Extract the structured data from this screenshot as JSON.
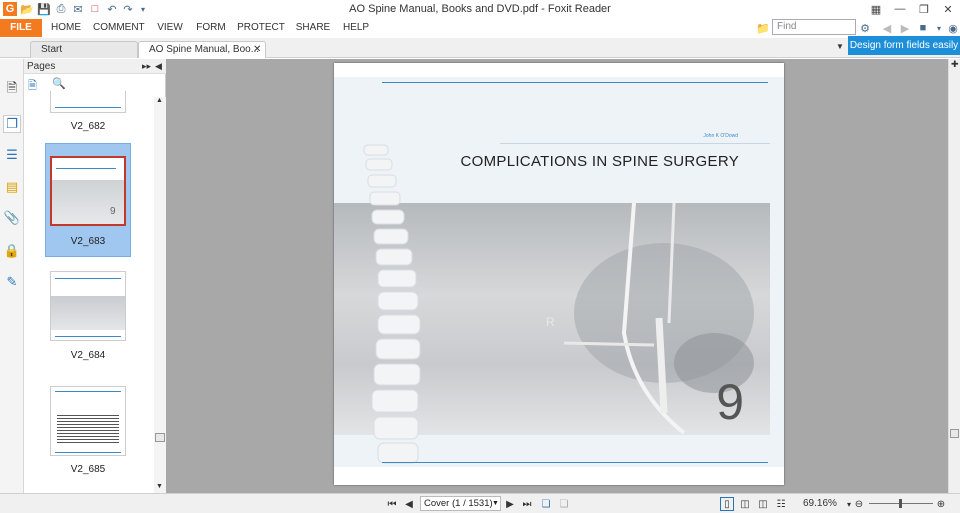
{
  "window": {
    "title": "AO Spine Manual, Books and DVD.pdf - Foxit Reader"
  },
  "quick_access": [
    "app-icon",
    "open-icon",
    "save-icon",
    "print-icon",
    "email-icon",
    "new-icon",
    "undo-icon",
    "redo-icon",
    "more-icon"
  ],
  "menu": {
    "items": [
      "FILE",
      "HOME",
      "COMMENT",
      "VIEW",
      "FORM",
      "PROTECT",
      "SHARE",
      "HELP"
    ]
  },
  "search": {
    "placeholder": "Find"
  },
  "tabs": [
    {
      "label": "Start"
    },
    {
      "label": "AO Spine Manual, Boo..."
    }
  ],
  "promo": {
    "text": "Design form fields easily"
  },
  "sidebar": {
    "panel_title": "Pages"
  },
  "thumbnails": [
    {
      "label": "V2_682"
    },
    {
      "label": "V2_683",
      "selected": true
    },
    {
      "label": "V2_684"
    },
    {
      "label": "V2_685"
    }
  ],
  "document": {
    "author": "John K O'Dowd",
    "title": "COMPLICATIONS IN SPINE SURGERY",
    "chapter": "9",
    "overlay_letter": "R"
  },
  "statusbar": {
    "page_select": "Cover (1 / 1531)",
    "zoom": "69.16%"
  },
  "colors": {
    "accent": "#f47a20",
    "promo": "#1d8fd8",
    "selection": "#9fc7ef",
    "document_rule": "#3a8ac6"
  }
}
